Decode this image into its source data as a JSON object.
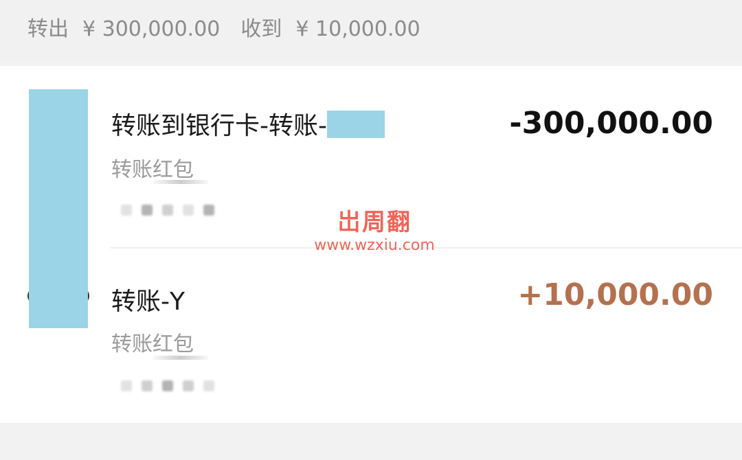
{
  "summary": {
    "out_label": "转出",
    "out_amount": "¥ 300,000.00",
    "in_label": "收到",
    "in_amount": "¥ 10,000.00"
  },
  "transactions": [
    {
      "title": "转账到银行卡-转账-",
      "subtitle": "转账红包",
      "amount": "-300,000.00",
      "amount_color": "#111111"
    },
    {
      "title": "转账-Y",
      "subtitle": "转账红包",
      "amount": "+10,000.00",
      "amount_color": "#b4714f"
    }
  ],
  "watermark": {
    "logo": "岀周翻",
    "url": "www.wzxiu.com"
  },
  "colors": {
    "mask": "#9bd4e6",
    "income": "#b4714f",
    "watermark": "#f04a3a"
  }
}
